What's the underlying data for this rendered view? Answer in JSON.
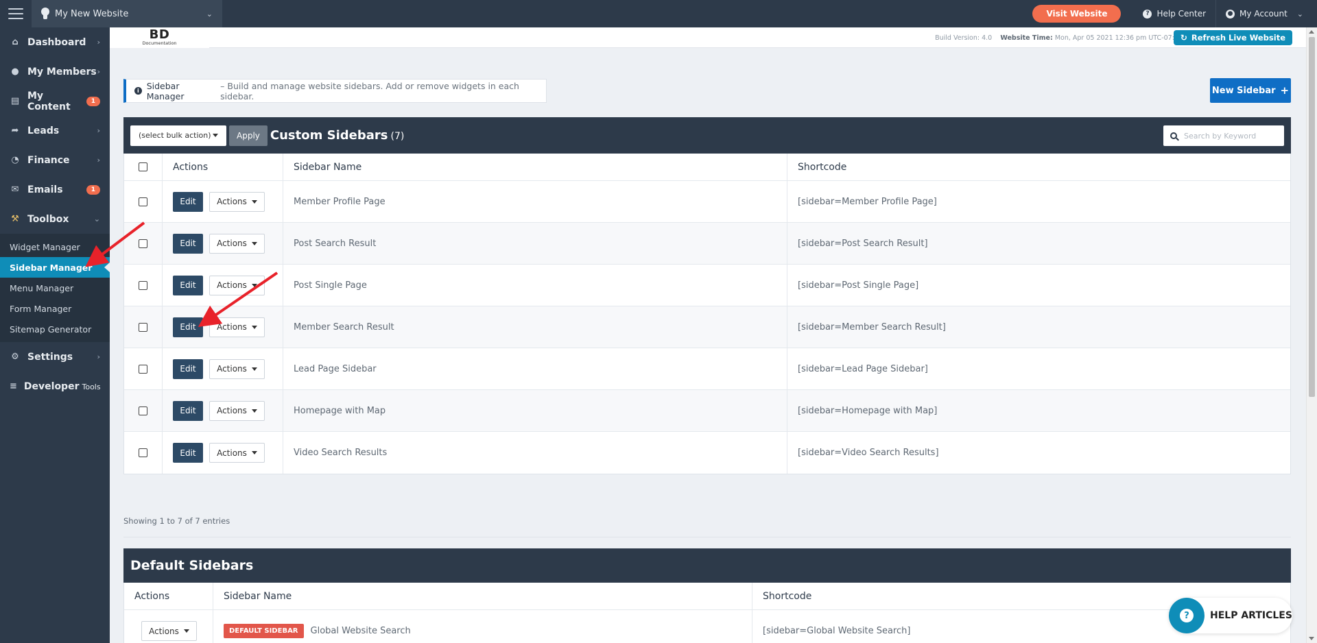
{
  "topbar": {
    "site_name": "My New Website",
    "visit_label": "Visit Website",
    "help_label": "Help Center",
    "account_label": "My Account"
  },
  "sidebar": {
    "items": [
      {
        "label": "Dashboard",
        "icon": "home-icon"
      },
      {
        "label": "My Members",
        "icon": "users-icon"
      },
      {
        "label": "My Content",
        "icon": "folder-icon",
        "badge": "1"
      },
      {
        "label": "Leads",
        "icon": "share-icon"
      },
      {
        "label": "Finance",
        "icon": "pie-icon"
      },
      {
        "label": "Emails",
        "icon": "envelope-icon",
        "badge": "1"
      },
      {
        "label": "Toolbox",
        "icon": "wrench-icon"
      }
    ],
    "sub_items": [
      "Widget Manager",
      "Sidebar Manager",
      "Menu Manager",
      "Form Manager",
      "Sitemap Generator"
    ],
    "bottom_items": [
      {
        "label": "Settings",
        "icon": "gear-icon"
      },
      {
        "label": "Developer",
        "small": "Tools",
        "icon": "sliders-icon"
      }
    ]
  },
  "brand": {
    "logo_big": "BD",
    "logo_small": "Documentation"
  },
  "build": {
    "version_label": "Build Version: 4.0",
    "time_label": "Website Time:",
    "time_value": "Mon, Apr 05 2021 12:36 pm UTC-07:00",
    "refresh_label": "Refresh Live Website"
  },
  "info": {
    "title": "Sidebar Manager",
    "text": "– Build and manage website sidebars. Add or remove widgets in each sidebar."
  },
  "new_sidebar_label": "New Sidebar",
  "custom": {
    "bulk_label": "(select bulk action)",
    "apply_label": "Apply",
    "title": "Custom Sidebars",
    "count": "(7)",
    "search_placeholder": "Search by Keyword",
    "columns": [
      "Actions",
      "Sidebar Name",
      "Shortcode"
    ],
    "edit_label": "Edit",
    "actions_label": "Actions",
    "rows": [
      {
        "name": "Member Profile Page",
        "code": "[sidebar=Member Profile Page]"
      },
      {
        "name": "Post Search Result",
        "code": "[sidebar=Post Search Result]"
      },
      {
        "name": "Post Single Page",
        "code": "[sidebar=Post Single Page]"
      },
      {
        "name": "Member Search Result",
        "code": "[sidebar=Member Search Result]"
      },
      {
        "name": "Lead Page Sidebar",
        "code": "[sidebar=Lead Page Sidebar]"
      },
      {
        "name": "Homepage with Map",
        "code": "[sidebar=Homepage with Map]"
      },
      {
        "name": "Video Search Results",
        "code": "[sidebar=Video Search Results]"
      }
    ],
    "showing": "Showing 1 to 7 of 7 entries"
  },
  "default": {
    "title": "Default Sidebars",
    "columns": [
      "Actions",
      "Sidebar Name",
      "Shortcode"
    ],
    "actions_label": "Actions",
    "badge_label": "DEFAULT SIDEBAR",
    "rows": [
      {
        "name": "Global Website Search",
        "code": "[sidebar=Global Website Search]"
      }
    ]
  },
  "help_articles_label": "HELP ARTICLES",
  "colors": {
    "accent": "#0f8db8",
    "dark": "#2d3a4a",
    "orange": "#f26e4e",
    "blue": "#0f6ec5",
    "annotation": "#e8222a"
  }
}
